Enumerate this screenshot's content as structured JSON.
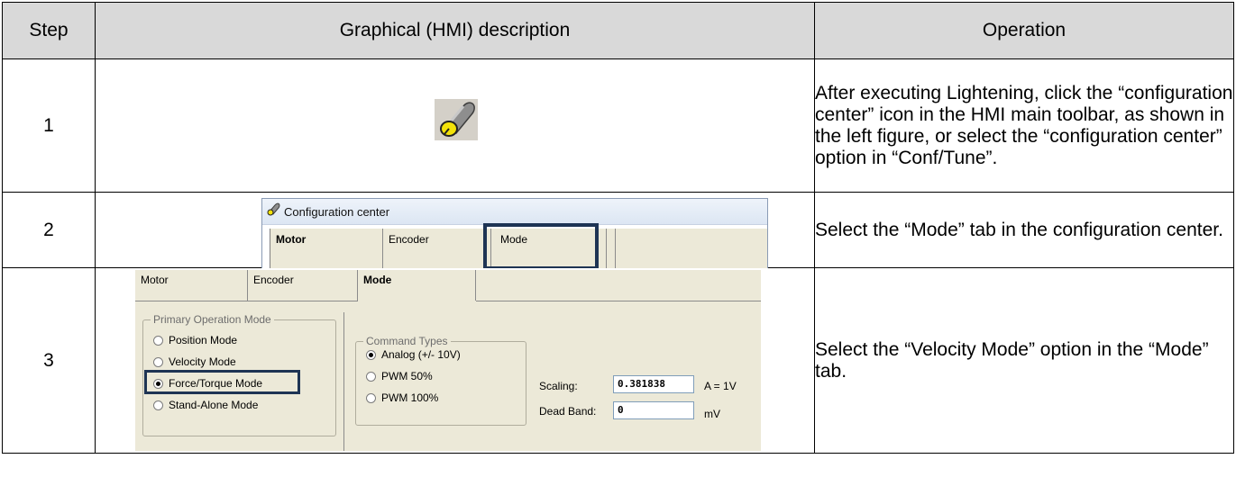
{
  "table": {
    "headers": {
      "step": "Step",
      "graphical": "Graphical (HMI) description",
      "operation": "Operation"
    },
    "rows": [
      {
        "step": "1",
        "operation": "After executing Lightening, click the “configuration center” icon in the HMI main toolbar, as shown in the left figure, or select the “configuration center” option in “Conf/Tune”."
      },
      {
        "step": "2",
        "operation": "Select the “Mode” tab in the configuration center."
      },
      {
        "step": "3",
        "operation": "Select the “Velocity Mode” option in the “Mode” tab."
      }
    ]
  },
  "step1": {
    "icon": "configuration-center-icon"
  },
  "step2": {
    "window_title": "Configuration center",
    "tabs": [
      "Motor",
      "Encoder",
      "Mode"
    ],
    "highlighted_tab": "Mode"
  },
  "step3": {
    "tabs": [
      "Motor",
      "Encoder",
      "Mode"
    ],
    "active_tab": "Mode",
    "primary_group_title": "Primary Operation Mode",
    "primary_modes": [
      {
        "label": "Position Mode",
        "selected": false
      },
      {
        "label": "Velocity Mode",
        "selected": false
      },
      {
        "label": "Force/Torque Mode",
        "selected": true
      },
      {
        "label": "Stand-Alone Mode",
        "selected": false
      }
    ],
    "command_group_title": "Command Types",
    "command_types": [
      {
        "label": "Analog (+/- 10V)",
        "selected": true
      },
      {
        "label": "PWM 50%",
        "selected": false
      },
      {
        "label": "PWM 100%",
        "selected": false
      }
    ],
    "scaling_label": "Scaling:",
    "scaling_value": "0.381838",
    "scaling_unit": "A = 1V",
    "deadband_label": "Dead Band:",
    "deadband_value": "0",
    "deadband_unit": "mV"
  },
  "colors": {
    "header_bg": "#d9d9d9",
    "highlight_box": "#1e3454",
    "panel_bg": "#ece9d8",
    "icon_yellow": "#f2e20a"
  }
}
